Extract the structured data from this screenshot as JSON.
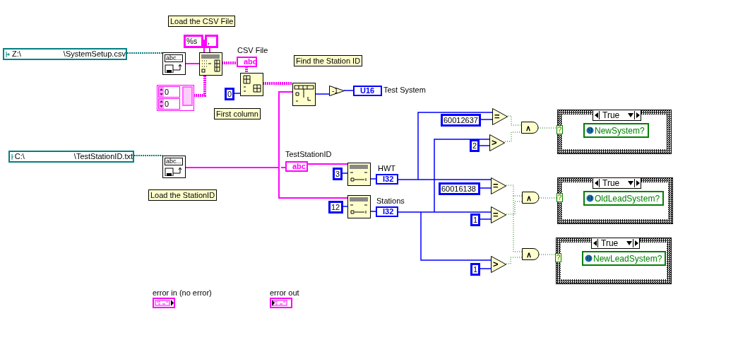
{
  "labels": [
    {
      "text": "Load the CSV File",
      "kind": "comment"
    },
    {
      "text": "CSV File",
      "kind": "label"
    },
    {
      "text": "Find the Station ID",
      "kind": "comment"
    },
    {
      "text": "First column",
      "kind": "comment"
    },
    {
      "text": "Test System",
      "kind": "label"
    },
    {
      "text": "Load the StationID",
      "kind": "comment"
    },
    {
      "text": "TestStationID",
      "kind": "label"
    },
    {
      "text": "HWT",
      "kind": "label"
    },
    {
      "text": "Stations",
      "kind": "label"
    }
  ],
  "path_constants": [
    {
      "prefix": "Z:\\",
      "suffix": "\\SystemSetup.csv"
    },
    {
      "prefix": "C:\\",
      "suffix": "\\TestStationID.txt"
    }
  ],
  "string_constants": [
    "%s",
    ","
  ],
  "array_constant": {
    "elements": [
      "0",
      "0"
    ]
  },
  "numeric_constants": [
    "0",
    "3",
    "12",
    "60012637",
    "2",
    "60016138",
    "1",
    "1"
  ],
  "file_nodes": [
    "abc...",
    "abc..."
  ],
  "indicators": [
    {
      "kind": "string",
      "text": "abc"
    },
    {
      "kind": "number",
      "text": "U16"
    },
    {
      "kind": "string",
      "text": "abc"
    },
    {
      "kind": "number",
      "text": "I32"
    },
    {
      "kind": "number",
      "text": "I32"
    }
  ],
  "decrement": "-1",
  "comparisons": [
    "=",
    ">",
    "=",
    "=",
    ">"
  ],
  "and_gates": [
    "∧",
    "∧",
    "∧"
  ],
  "case_structures": [
    {
      "selector": "True",
      "terminal": "?",
      "property": "NewSystem?"
    },
    {
      "selector": "True",
      "terminal": "?",
      "property": "OldLeadSystem?"
    },
    {
      "selector": "True",
      "terminal": "?",
      "property": "NewLeadSystem?"
    }
  ],
  "error_clusters": [
    {
      "label": "error in (no error)",
      "kind": "control"
    },
    {
      "label": "error out",
      "kind": "indicator"
    }
  ]
}
